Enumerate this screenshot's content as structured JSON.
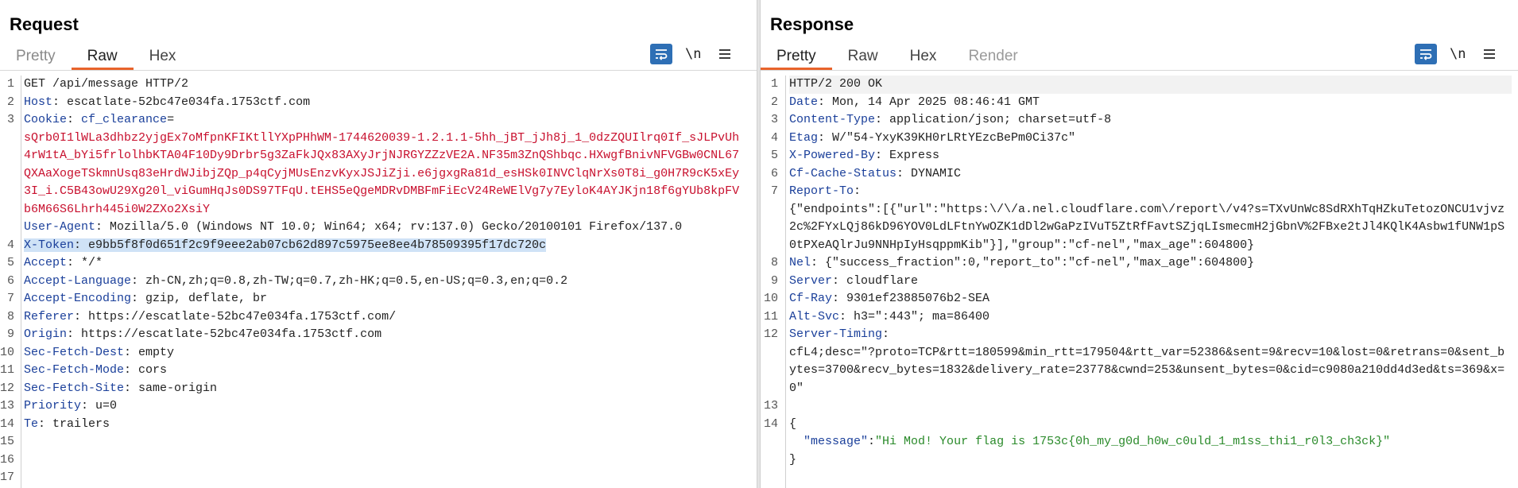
{
  "request": {
    "title": "Request",
    "tabs": [
      "Pretty",
      "Raw",
      "Hex"
    ],
    "active_tab": "Raw",
    "line_numbers": [
      "1",
      "2",
      "3",
      "",
      "",
      "",
      "",
      "",
      "",
      "4",
      "5",
      "6",
      "7",
      "8",
      "9",
      "10",
      "11",
      "12",
      "13",
      "14",
      "15",
      "16",
      "17"
    ],
    "lines": [
      [
        {
          "t": "GET /api/message HTTP/2",
          "c": ""
        }
      ],
      [
        {
          "t": "Host",
          "c": "hk"
        },
        {
          "t": ": escatlate-52bc47e034fa.1753ctf.com",
          "c": ""
        }
      ],
      [
        {
          "t": "Cookie",
          "c": "hk"
        },
        {
          "t": ": ",
          "c": ""
        },
        {
          "t": "cf_clearance",
          "c": "hk"
        },
        {
          "t": "=",
          "c": ""
        }
      ],
      [
        {
          "t": "sQrb0I1lWLa3dhbz2yjgEx7oMfpnKFIKtllYXpPHhWM-1744620039-1.2.1.1-5hh_jBT_jJh8j_1_0dzZQUIlrq0If_sJLPvUh",
          "c": "red"
        }
      ],
      [
        {
          "t": "4rW1tA_bYi5frlolhbKTA04F10Dy9Drbr5g3ZaFkJQx83AXyJrjNJRGYZZzVE2A.NF35m3ZnQShbqc.HXwgfBnivNFVGBw0CNL67",
          "c": "red"
        }
      ],
      [
        {
          "t": "QXAaXogeTSkmnUsq83eHrdWJibjZQp_p4qCyjMUsEnzvKyxJSJiZji.e6jgxgRa81d_esHSk0INVClqNrXs0T8i_g0H7R9cK5xEy",
          "c": "red"
        }
      ],
      [
        {
          "t": "3I_i.C5B43owU29Xg20l_viGumHqJs0DS97TFqU.tEHS5eQgeMDRvDMBFmFiEcV24ReWElVg7y7EyloK4AYJKjn18f6gYUb8kpFV",
          "c": "red"
        }
      ],
      [
        {
          "t": "b6M66S6Lhrh445i0W2ZXo2XsiY",
          "c": "red"
        }
      ],
      [
        {
          "t": "User-Agent",
          "c": "hk"
        },
        {
          "t": ": Mozilla/5.0 (Windows NT 10.0; Win64; x64; rv:137.0) Gecko/20100101 Firefox/137.0",
          "c": ""
        }
      ],
      [
        {
          "t": "X-Token",
          "c": "hk hl"
        },
        {
          "t": ": e9bb5f8f0d651f2c9f9eee2ab07cb62d897c5975ee8ee4b78509395f17dc720c",
          "c": "hl"
        }
      ],
      [
        {
          "t": "Accept",
          "c": "hk"
        },
        {
          "t": ": */*",
          "c": ""
        }
      ],
      [
        {
          "t": "Accept-Language",
          "c": "hk"
        },
        {
          "t": ": zh-CN,zh;q=0.8,zh-TW;q=0.7,zh-HK;q=0.5,en-US;q=0.3,en;q=0.2",
          "c": ""
        }
      ],
      [
        {
          "t": "Accept-Encoding",
          "c": "hk"
        },
        {
          "t": ": gzip, deflate, br",
          "c": ""
        }
      ],
      [
        {
          "t": "Referer",
          "c": "hk"
        },
        {
          "t": ": https://escatlate-52bc47e034fa.1753ctf.com/",
          "c": ""
        }
      ],
      [
        {
          "t": "Origin",
          "c": "hk"
        },
        {
          "t": ": https://escatlate-52bc47e034fa.1753ctf.com",
          "c": ""
        }
      ],
      [
        {
          "t": "Sec-Fetch-Dest",
          "c": "hk"
        },
        {
          "t": ": empty",
          "c": ""
        }
      ],
      [
        {
          "t": "Sec-Fetch-Mode",
          "c": "hk"
        },
        {
          "t": ": cors",
          "c": ""
        }
      ],
      [
        {
          "t": "Sec-Fetch-Site",
          "c": "hk"
        },
        {
          "t": ": same-origin",
          "c": ""
        }
      ],
      [
        {
          "t": "Priority",
          "c": "hk"
        },
        {
          "t": ": u=0",
          "c": ""
        }
      ],
      [
        {
          "t": "Te",
          "c": "hk"
        },
        {
          "t": ": trailers",
          "c": ""
        }
      ],
      [
        {
          "t": "",
          "c": ""
        }
      ],
      [
        {
          "t": "",
          "c": ""
        }
      ]
    ]
  },
  "response": {
    "title": "Response",
    "tabs": [
      "Pretty",
      "Raw",
      "Hex",
      "Render"
    ],
    "active_tab": "Pretty",
    "line_numbers": [
      "1",
      "2",
      "3",
      "4",
      "5",
      "6",
      "7",
      "",
      "",
      "",
      "8",
      "9",
      "10",
      "11",
      "12",
      "",
      "",
      "",
      "13",
      "14",
      "",
      ""
    ],
    "lines": [
      [
        {
          "t": "HTTP/2 200 OK",
          "c": ""
        }
      ],
      [
        {
          "t": "Date",
          "c": "hk"
        },
        {
          "t": ": Mon, 14 Apr 2025 08:46:41 GMT",
          "c": ""
        }
      ],
      [
        {
          "t": "Content-Type",
          "c": "hk"
        },
        {
          "t": ": application/json; charset=utf-8",
          "c": ""
        }
      ],
      [
        {
          "t": "Etag",
          "c": "hk"
        },
        {
          "t": ": W/\"54-YxyK39KH0rLRtYEzcBePm0Ci37c\"",
          "c": ""
        }
      ],
      [
        {
          "t": "X-Powered-By",
          "c": "hk"
        },
        {
          "t": ": Express",
          "c": ""
        }
      ],
      [
        {
          "t": "Cf-Cache-Status",
          "c": "hk"
        },
        {
          "t": ": DYNAMIC",
          "c": ""
        }
      ],
      [
        {
          "t": "Report-To",
          "c": "hk"
        },
        {
          "t": ":",
          "c": ""
        }
      ],
      [
        {
          "t": "{\"endpoints\":[{\"url\":\"https:\\/\\/a.nel.cloudflare.com\\/report\\/v4?s=TXvUnWc8SdRXhTqHZkuTetozONCU1vjvz",
          "c": ""
        }
      ],
      [
        {
          "t": "2c%2FYxLQj86kD96YOV0LdLFtnYwOZK1dDl2wGaPzIVuT5ZtRfFavtSZjqLIsmecmH2jGbnV%2FBxe2tJl4KQlK4Asbw1fUNW1pS",
          "c": ""
        }
      ],
      [
        {
          "t": "0tPXeAQlrJu9NNHpIyHsqppmKib\"}],\"group\":\"cf-nel\",\"max_age\":604800}",
          "c": ""
        }
      ],
      [
        {
          "t": "Nel",
          "c": "hk"
        },
        {
          "t": ": {\"success_fraction\":0,\"report_to\":\"cf-nel\",\"max_age\":604800}",
          "c": ""
        }
      ],
      [
        {
          "t": "Server",
          "c": "hk"
        },
        {
          "t": ": cloudflare",
          "c": ""
        }
      ],
      [
        {
          "t": "Cf-Ray",
          "c": "hk"
        },
        {
          "t": ": 9301ef23885076b2-SEA",
          "c": ""
        }
      ],
      [
        {
          "t": "Alt-Svc",
          "c": "hk"
        },
        {
          "t": ": h3=\":443\"; ma=86400",
          "c": ""
        }
      ],
      [
        {
          "t": "Server-Timing",
          "c": "hk"
        },
        {
          "t": ":",
          "c": ""
        }
      ],
      [
        {
          "t": "cfL4;desc=\"?proto=TCP&rtt=180599&min_rtt=179504&rtt_var=52386&sent=9&recv=10&lost=0&retrans=0&sent_b",
          "c": ""
        }
      ],
      [
        {
          "t": "ytes=3700&recv_bytes=1832&delivery_rate=23778&cwnd=253&unsent_bytes=0&cid=c9080a210dd4d3ed&ts=369&x=",
          "c": ""
        }
      ],
      [
        {
          "t": "0\"",
          "c": ""
        }
      ],
      [
        {
          "t": "",
          "c": ""
        }
      ],
      [
        {
          "t": "{",
          "c": ""
        }
      ],
      [
        {
          "t": "  ",
          "c": ""
        },
        {
          "t": "\"message\"",
          "c": "hk"
        },
        {
          "t": ":",
          "c": ""
        },
        {
          "t": "\"Hi Mod! Your flag is 1753c{0h_my_g0d_h0w_c0uld_1_m1ss_thi1_r0l3_ch3ck}\"",
          "c": "grn"
        }
      ],
      [
        {
          "t": "}",
          "c": ""
        }
      ]
    ]
  },
  "icons": {
    "wrap_toggle": "wrap-lines-icon",
    "newline_label": "\\n",
    "menu": "hamburger-menu-icon"
  },
  "colors": {
    "accent": "#e8632b",
    "header_key": "#1a3f9a",
    "cookie_value": "#c8102e",
    "json_string": "#2a8a2a",
    "selection": "#cfe2f6",
    "button_blue": "#2e6fb5"
  }
}
